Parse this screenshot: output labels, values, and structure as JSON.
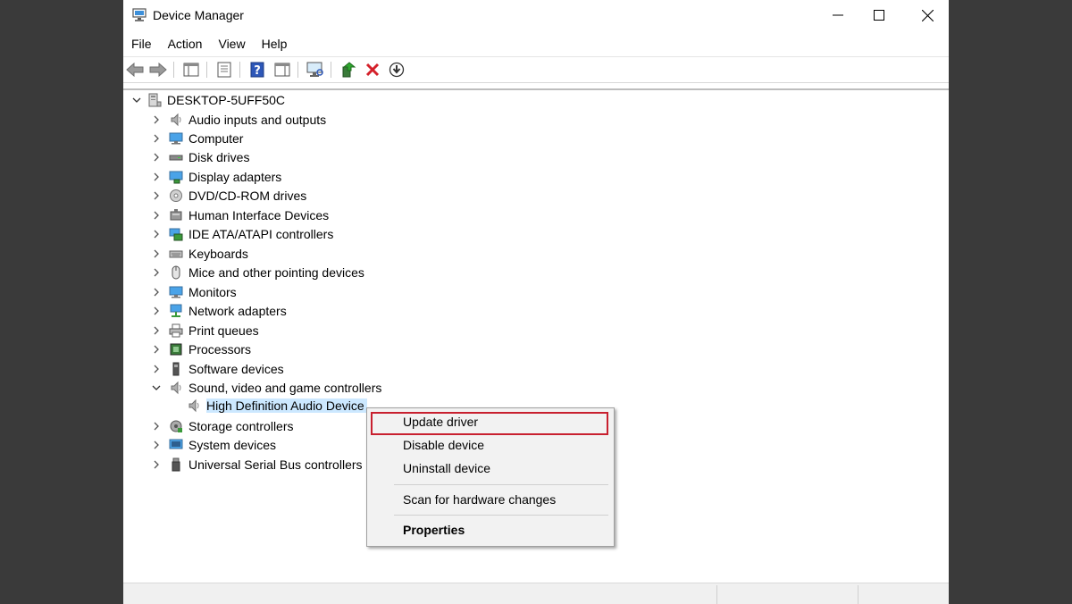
{
  "window": {
    "title": "Device Manager"
  },
  "menubar": [
    "File",
    "Action",
    "View",
    "Help"
  ],
  "tree": {
    "root": "DESKTOP-5UFF50C",
    "categories": [
      {
        "label": "Audio inputs and outputs",
        "icon": "speaker-icon"
      },
      {
        "label": "Computer",
        "icon": "computer-monitor-icon"
      },
      {
        "label": "Disk drives",
        "icon": "disk-drive-icon"
      },
      {
        "label": "Display adapters",
        "icon": "display-adapter-icon"
      },
      {
        "label": "DVD/CD-ROM drives",
        "icon": "dvd-drive-icon"
      },
      {
        "label": "Human Interface Devices",
        "icon": "hid-icon"
      },
      {
        "label": "IDE ATA/ATAPI controllers",
        "icon": "ide-controller-icon"
      },
      {
        "label": "Keyboards",
        "icon": "keyboard-icon"
      },
      {
        "label": "Mice and other pointing devices",
        "icon": "mouse-icon"
      },
      {
        "label": "Monitors",
        "icon": "monitor-icon"
      },
      {
        "label": "Network adapters",
        "icon": "network-adapter-icon"
      },
      {
        "label": "Print queues",
        "icon": "printer-icon"
      },
      {
        "label": "Processors",
        "icon": "processor-icon"
      },
      {
        "label": "Software devices",
        "icon": "software-device-icon"
      },
      {
        "label": "Sound, video and game controllers",
        "icon": "speaker-icon",
        "expanded": true
      },
      {
        "label": "Storage controllers",
        "icon": "storage-controller-icon"
      },
      {
        "label": "System devices",
        "icon": "system-device-icon"
      },
      {
        "label": "Universal Serial Bus controllers",
        "icon": "usb-icon"
      }
    ],
    "selected_child": "High Definition Audio Device"
  },
  "context_menu": {
    "update": "Update driver",
    "disable": "Disable device",
    "uninstall": "Uninstall device",
    "scan": "Scan for hardware changes",
    "properties": "Properties"
  },
  "colors": {
    "selection": "#cce8ff",
    "highlight_box": "#c8202f"
  }
}
